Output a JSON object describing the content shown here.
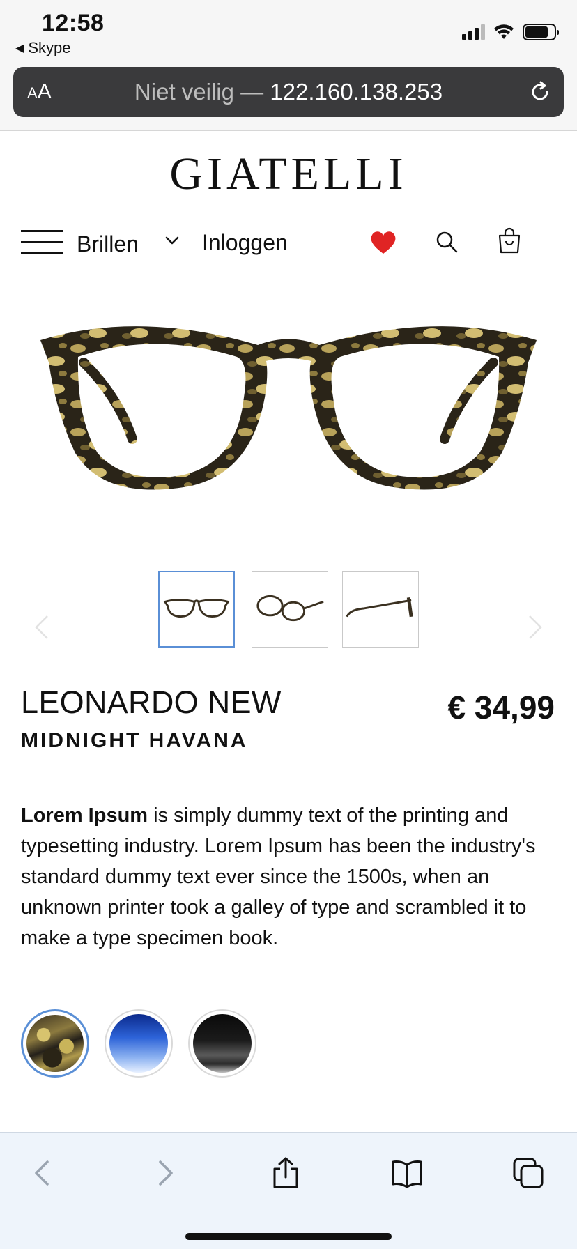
{
  "status_bar": {
    "time": "12:58",
    "back_app": "Skype"
  },
  "browser": {
    "text_size_label": "AA",
    "security_label": "Niet veilig —",
    "address": "122.160.138.253"
  },
  "site": {
    "logo": "GIATELLI",
    "nav": {
      "menu_label": "Brillen",
      "login_label": "Inloggen"
    }
  },
  "product": {
    "name": "LEONARDO NEW",
    "color_name": "MIDNIGHT HAVANA",
    "price": "€ 34,99",
    "description_bold": "Lorem Ipsum",
    "description_rest": " is simply dummy text of the printing and typesetting industry. Lorem Ipsum has been the industry's standard dummy text ever since the 1500s, when an unknown printer took a galley of type and scrambled it to make a type specimen book.",
    "thumbnails": [
      "front-view",
      "angled-view",
      "side-view"
    ],
    "active_thumbnail": 0,
    "swatches": [
      "havana",
      "blue",
      "black"
    ],
    "active_swatch": 0
  },
  "colors": {
    "accent": "#5a8fd6",
    "heart": "#e02424",
    "url_bar": "#3a3a3c",
    "toolbar_bg": "#eef4fb"
  },
  "icons": {
    "status": [
      "signal-icon",
      "wifi-icon",
      "battery-icon"
    ],
    "nav": [
      "hamburger-icon",
      "chevron-down-icon",
      "heart-icon",
      "search-icon",
      "shopping-bag-icon"
    ],
    "toolbar": [
      "back-icon",
      "forward-icon",
      "share-icon",
      "bookmarks-icon",
      "tabs-icon"
    ]
  }
}
